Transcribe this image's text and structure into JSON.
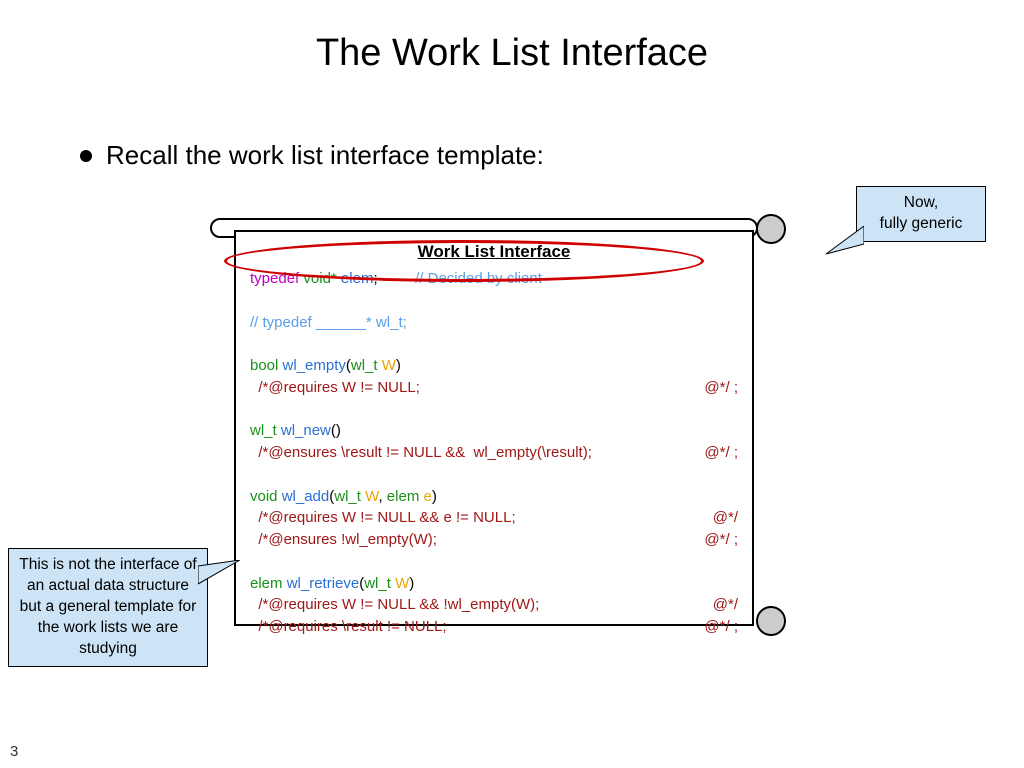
{
  "title": "The Work List Interface",
  "bullet": "Recall the work list interface template:",
  "codeTitle": "Work List Interface",
  "code": {
    "l1": {
      "typedef": "typedef",
      "voidptr": "void*",
      "elem": "elem",
      "semi": ";",
      "comment": "// Decided by client"
    },
    "l2": "// typedef ______* wl_t;",
    "wl_empty": {
      "ret": "bool",
      "fn": "wl_empty",
      "p1t": "wl_t",
      "p1n": "W",
      "req": "  /*@requires W != NULL;",
      "end": "@*/ ;"
    },
    "wl_new": {
      "ret": "wl_t",
      "fn": "wl_new",
      "ens": "  /*@ensures \\result != NULL &&  wl_empty(\\result);",
      "end": "@*/ ;"
    },
    "wl_add": {
      "ret": "void",
      "fn": "wl_add",
      "p1t": "wl_t",
      "p1n": "W",
      "p2t": "elem",
      "p2n": "e",
      "req": "  /*@requires W != NULL && e != NULL;",
      "reqEnd": "@*/",
      "ens": "  /*@ensures !wl_empty(W);",
      "ensEnd": "@*/ ;"
    },
    "wl_retrieve": {
      "ret": "elem",
      "fn": "wl_retrieve",
      "p1t": "wl_t",
      "p1n": "W",
      "req1": "  /*@requires W != NULL && !wl_empty(W);",
      "req1End": "@*/",
      "req2": "  /*@requires \\result != NULL;",
      "req2End": "@*/ ;"
    }
  },
  "calloutRight": "Now,\nfully generic",
  "calloutLeft": "This is not the interface of an actual data structure but a general template for the work lists we are studying",
  "pageNumber": "3"
}
